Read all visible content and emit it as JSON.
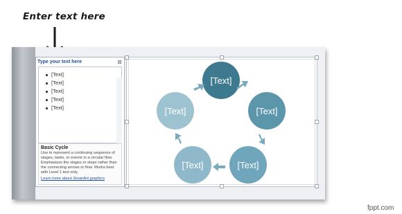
{
  "callout": {
    "text": "Enter text here"
  },
  "text_pane": {
    "title": "Type your text here",
    "close_glyph": "⊠",
    "bullets": [
      "[Text]",
      "[Text]",
      "[Text]",
      "[Text]",
      "[Text]"
    ]
  },
  "description": {
    "title": "Basic Cycle",
    "body": "Use to represent a continuing sequence of stages, tasks, or events in a circular flow. Emphasizes the stages or steps rather than the connecting arrows or flow. Works best with Level 1 text only.",
    "link": "Learn more about SmartArt graphics"
  },
  "diagram": {
    "nodes": [
      "[Text]",
      "[Text]",
      "[Text]",
      "[Text]",
      "[Text]"
    ],
    "colors": [
      "#3d7a8f",
      "#5b96ab",
      "#6fa6bb",
      "#8fb9ca",
      "#9dc3d1"
    ]
  },
  "watermark": "fppt.com"
}
